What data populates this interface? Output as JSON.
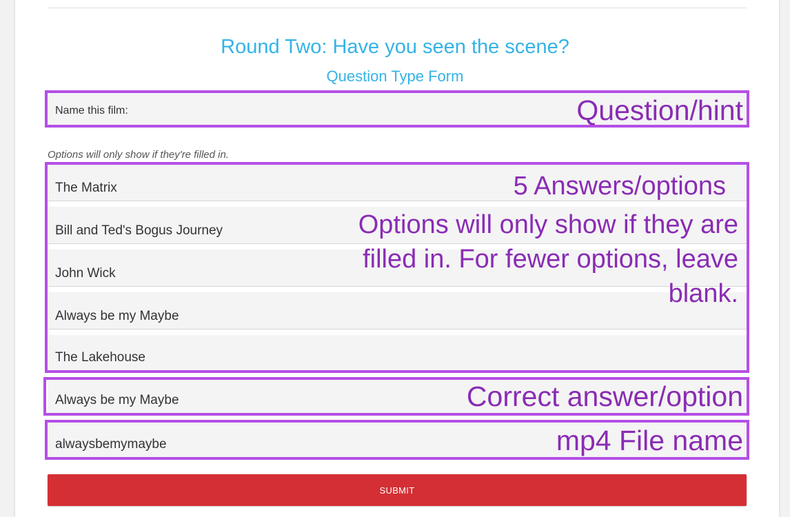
{
  "header": {
    "title": "Round Two: Have you seen the scene?",
    "subtitle": "Question Type Form"
  },
  "form": {
    "question_value": "Name this film:",
    "options_note": "Options will only show if they're filled in.",
    "options": [
      "The Matrix",
      "Bill and Ted's Bogus Journey",
      "John Wick",
      "Always be my Maybe",
      "The Lakehouse"
    ],
    "correct_answer": "Always be my Maybe",
    "file_name": "alwaysbemymaybe",
    "submit_label": "SUBMIT"
  },
  "annotations": {
    "question": "Question/hint",
    "answers": "5 Answers/options",
    "options_help_1": "Options will only show if they are",
    "options_help_2": "filled in. For fewer options, leave",
    "options_help_3": "blank.",
    "correct": "Correct answer/option",
    "file": "mp4 File name",
    "color": "#b54fe6"
  },
  "theme": {
    "title_color": "#35b3e6",
    "submit_color": "#d32f34"
  }
}
